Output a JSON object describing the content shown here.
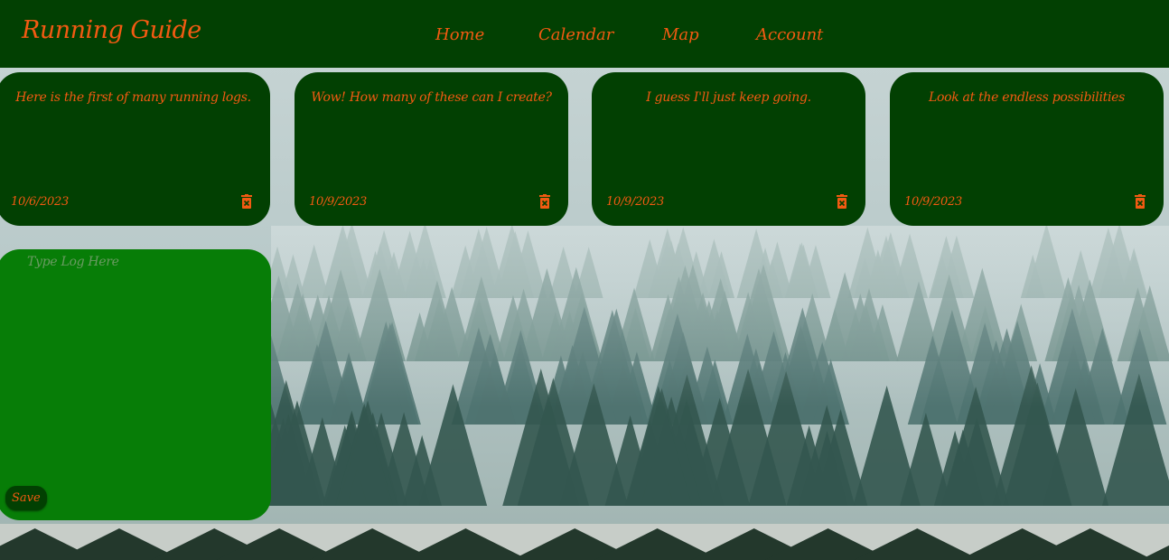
{
  "app": {
    "title": "Running Guide"
  },
  "nav": {
    "items": [
      {
        "label": "Home"
      },
      {
        "label": "Calendar"
      },
      {
        "label": "Map"
      },
      {
        "label": "Account"
      }
    ]
  },
  "logs": [
    {
      "text": "Here is the first of many running logs.",
      "date": "10/6/2023",
      "delete_icon": "trash-icon"
    },
    {
      "text": "Wow! How many of these can I create?",
      "date": "10/9/2023",
      "delete_icon": "trash-icon"
    },
    {
      "text": "I guess I'll just keep going.",
      "date": "10/9/2023",
      "delete_icon": "trash-icon"
    },
    {
      "text": "Look at the endless possibilities",
      "date": "10/9/2023",
      "delete_icon": "trash-icon"
    }
  ],
  "editor": {
    "value": "",
    "placeholder": "Type Log Here",
    "save_label": "Save"
  },
  "colors": {
    "header_bg": "#024002",
    "card_bg": "#024002",
    "editor_bg": "#077d07",
    "accent": "#f25a12"
  }
}
